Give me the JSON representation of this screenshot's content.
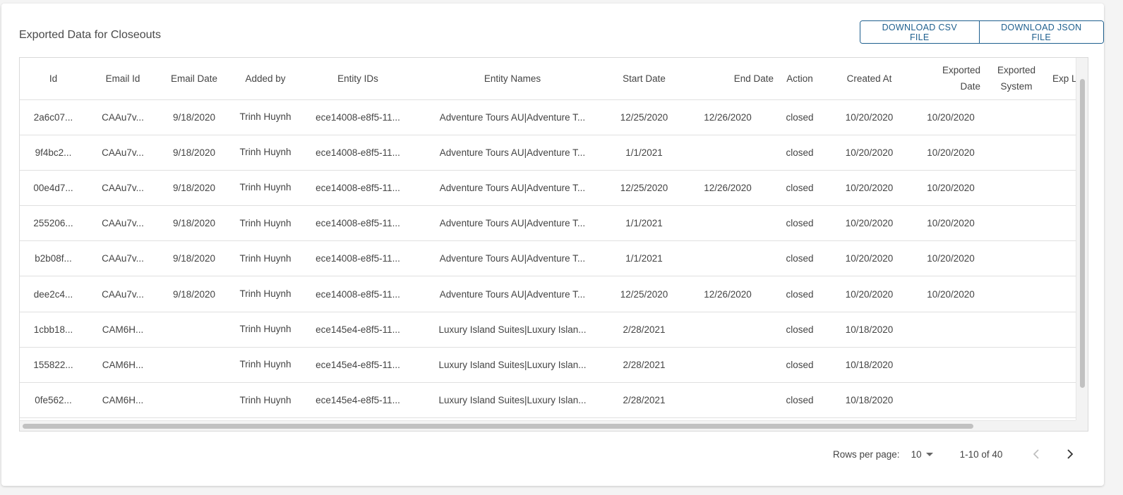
{
  "title": "Exported Data for Closeouts",
  "buttons": {
    "download_csv": "DOWNLOAD CSV FILE",
    "download_json": "DOWNLOAD JSON FILE"
  },
  "table": {
    "headers": [
      "Id",
      "Email Id",
      "Email Date",
      "Added by",
      "Entity IDs",
      "Entity Names",
      "Start Date",
      "End Date",
      "Action",
      "Created At",
      "Exported Date",
      "Exported System",
      "Exp Log"
    ],
    "rows": [
      [
        "2a6c07...",
        "CAAu7v...",
        "9/18/2020",
        "Trinh Huynh",
        "ece14008-e8f5-11...",
        "Adventure Tours AU|Adventure T...",
        "12/25/2020",
        "12/26/2020",
        "closed",
        "10/20/2020",
        "10/20/2020",
        "",
        ""
      ],
      [
        "9f4bc2...",
        "CAAu7v...",
        "9/18/2020",
        "Trinh Huynh",
        "ece14008-e8f5-11...",
        "Adventure Tours AU|Adventure T...",
        "1/1/2021",
        "",
        "closed",
        "10/20/2020",
        "10/20/2020",
        "",
        ""
      ],
      [
        "00e4d7...",
        "CAAu7v...",
        "9/18/2020",
        "Trinh Huynh",
        "ece14008-e8f5-11...",
        "Adventure Tours AU|Adventure T...",
        "12/25/2020",
        "12/26/2020",
        "closed",
        "10/20/2020",
        "10/20/2020",
        "",
        ""
      ],
      [
        "255206...",
        "CAAu7v...",
        "9/18/2020",
        "Trinh Huynh",
        "ece14008-e8f5-11...",
        "Adventure Tours AU|Adventure T...",
        "1/1/2021",
        "",
        "closed",
        "10/20/2020",
        "10/20/2020",
        "",
        ""
      ],
      [
        "b2b08f...",
        "CAAu7v...",
        "9/18/2020",
        "Trinh Huynh",
        "ece14008-e8f5-11...",
        "Adventure Tours AU|Adventure T...",
        "1/1/2021",
        "",
        "closed",
        "10/20/2020",
        "10/20/2020",
        "",
        ""
      ],
      [
        "dee2c4...",
        "CAAu7v...",
        "9/18/2020",
        "Trinh Huynh",
        "ece14008-e8f5-11...",
        "Adventure Tours AU|Adventure T...",
        "12/25/2020",
        "12/26/2020",
        "closed",
        "10/20/2020",
        "10/20/2020",
        "",
        ""
      ],
      [
        "1cbb18...",
        "CAM6H...",
        "",
        "Trinh Huynh",
        "ece145e4-e8f5-11...",
        "Luxury Island Suites|Luxury Islan...",
        "2/28/2021",
        "",
        "closed",
        "10/18/2020",
        "",
        "",
        ""
      ],
      [
        "155822...",
        "CAM6H...",
        "",
        "Trinh Huynh",
        "ece145e4-e8f5-11...",
        "Luxury Island Suites|Luxury Islan...",
        "2/28/2021",
        "",
        "closed",
        "10/18/2020",
        "",
        "",
        ""
      ],
      [
        "0fe562...",
        "CAM6H...",
        "",
        "Trinh Huynh",
        "ece145e4-e8f5-11...",
        "Luxury Island Suites|Luxury Islan...",
        "2/28/2021",
        "",
        "closed",
        "10/18/2020",
        "",
        "",
        ""
      ]
    ]
  },
  "pagination": {
    "rows_per_page_label": "Rows per page:",
    "rows_per_page_value": "10",
    "range": "1-10 of 40"
  },
  "icons": {
    "prev": "chevron-left-icon",
    "next": "chevron-right-icon",
    "dropdown": "caret-down-icon"
  },
  "colors": {
    "accent": "#1e5f8e",
    "disabled_icon": "#bdbdbd",
    "active_icon": "#333333"
  }
}
